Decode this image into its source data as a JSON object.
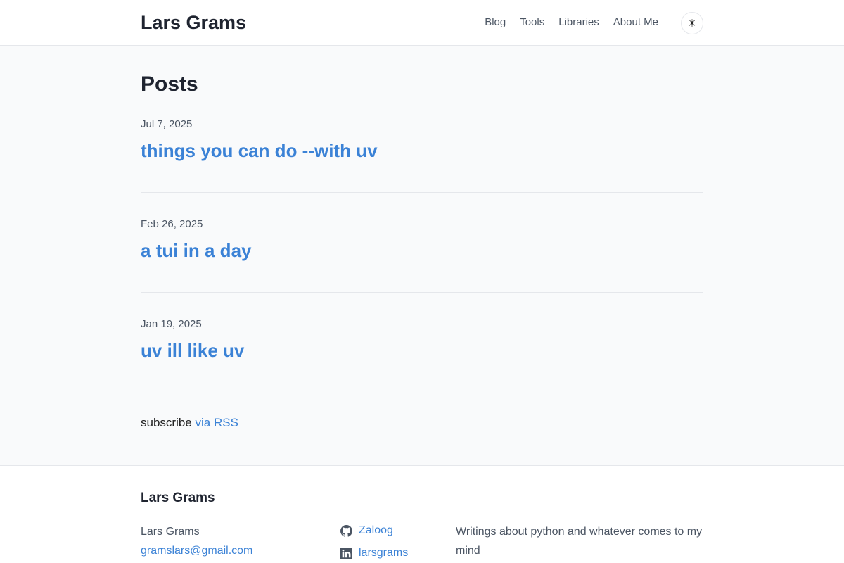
{
  "header": {
    "brand": "Lars Grams",
    "nav": [
      "Blog",
      "Tools",
      "Libraries",
      "About Me"
    ],
    "theme_toggle_icon": "☀"
  },
  "main": {
    "heading": "Posts",
    "posts": [
      {
        "date": "Jul 7, 2025",
        "title": "things you can do --with uv"
      },
      {
        "date": "Feb 26, 2025",
        "title": "a tui in a day"
      },
      {
        "date": "Jan 19, 2025",
        "title": "uv ill like uv"
      }
    ],
    "subscribe_text": "subscribe",
    "subscribe_link": "via RSS"
  },
  "footer": {
    "title": "Lars Grams",
    "name": "Lars Grams",
    "email": "gramslars@gmail.com",
    "social": [
      {
        "icon": "github-icon",
        "label": "Zaloog"
      },
      {
        "icon": "linkedin-icon",
        "label": "larsgrams"
      }
    ],
    "description": "Writings about python and whatever comes to my mind"
  },
  "colors": {
    "accent": "#3b82d6",
    "background": "#f9fafb",
    "header_background": "#ffffff",
    "divider": "#e5e7eb"
  }
}
